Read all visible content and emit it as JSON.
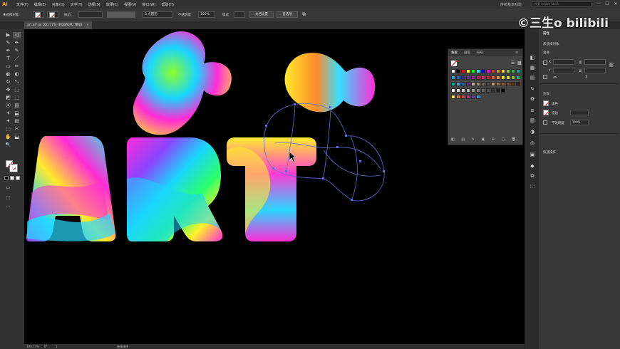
{
  "app": {
    "logo": "Ai"
  },
  "menu": [
    "文件(F)",
    "编辑(E)",
    "对象(O)",
    "文字(T)",
    "选择(S)",
    "效果(C)",
    "视图(V)",
    "窗口(W)",
    "帮助(H)"
  ],
  "workspace": {
    "name": "传统基本功能",
    "search_placeholder": "搜索 Adobe Stock"
  },
  "window_buttons": [
    "—",
    "☐",
    "✕"
  ],
  "control": {
    "selection_label": "未选择对象",
    "stroke_label": "描边",
    "brush_label": "3 点圆形",
    "opacity_label": "不透明度",
    "opacity_value": "100%",
    "style_label": "样式",
    "doc_setup": "文档设置",
    "prefs": "首选项"
  },
  "document_tab": {
    "label": "art.ai* @ 100.77% (RGB/GPU 预览)",
    "close": "×"
  },
  "tools": [
    "▶",
    "◁",
    "✎",
    "✒",
    "T",
    "／",
    "▭",
    "✏",
    "◐",
    "↻",
    "⤡",
    "✥",
    "⬚",
    "◩",
    "✦",
    "⦿",
    "▤",
    "⬓",
    "✂",
    "✋",
    "🔍"
  ],
  "canvas": {
    "letters": [
      "A",
      "R",
      "T"
    ]
  },
  "status": {
    "zoom": "100.77%",
    "rotate": "0°",
    "page": "1",
    "tool": "直接选择"
  },
  "swatches_panel": {
    "tabs": [
      "色板",
      "画笔",
      "符号"
    ],
    "colors_row1": [
      "#ffffff",
      "#000000",
      "#ff0000",
      "#ffff00",
      "#00ff00",
      "#00ffff",
      "#0000ff",
      "#ff00ff",
      "#e63a2e",
      "#f08a24",
      "#f6d628",
      "#8dc63f",
      "#39b54a",
      "#00a99d"
    ],
    "colors_row2": [
      "#29abe2",
      "#0071bc",
      "#2e3192",
      "#662d91",
      "#93278f",
      "#d4145a",
      "#ed1e79",
      "#c1272d",
      "#f15a24",
      "#f7931e",
      "#fcee21",
      "#d9e021",
      "#8cc63f",
      "#22b573"
    ],
    "colors_row3": [
      "#00a99d",
      "#29abe2",
      "#0071bc",
      "#662d91",
      "#c7b299",
      "#998675",
      "#736357",
      "#534741",
      "#c69c6d",
      "#a67c52",
      "#8c6239",
      "#754c24",
      "#603813",
      "#42210b"
    ],
    "colors_row4": [
      "#ffffff",
      "#e6e6e6",
      "#cccccc",
      "#b3b3b3",
      "#999999",
      "#808080",
      "#666666",
      "#4d4d4d",
      "#333333",
      "#1a1a1a",
      "#000000"
    ],
    "colors_row5": [
      "#f5e34a",
      "#ef7f2a",
      "#e83e4c",
      "#b8317e",
      "#5b4aa4",
      "#2d9bd7"
    ]
  },
  "props_panel": {
    "title": "属性",
    "section1": "未选择对象",
    "transform": "变换",
    "x_label": "X",
    "y_label": "Y",
    "w_label": "宽",
    "h_label": "高",
    "appearance": "外观",
    "fill_label": "填色",
    "stroke_label": "描边",
    "opacity_label": "不透明度",
    "opacity_value": "100%",
    "quick_actions": "快速操作"
  },
  "watermark": "©三生o bilibili"
}
